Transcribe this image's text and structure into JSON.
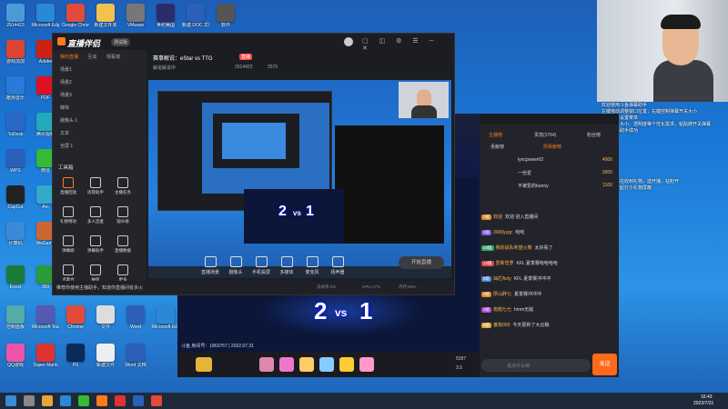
{
  "desktop": {
    "icons": [
      {
        "label": "2914423",
        "color": "#4a9ad8"
      },
      {
        "label": "Microsoft Edge",
        "color": "#2a88d8"
      },
      {
        "label": "Google Chrome",
        "color": "#e24a3b"
      },
      {
        "label": "新建文件夹",
        "color": "#f2c14e"
      },
      {
        "label": "VMware",
        "color": "#777777"
      },
      {
        "label": "世纪美国",
        "color": "#2c2c6c"
      },
      {
        "label": "新建 DOC 文档",
        "color": "#2b5fb8"
      },
      {
        "label": "软件",
        "color": "#555555"
      },
      {
        "label": "游戏加加",
        "color": "#d43"
      },
      {
        "label": "Adobe",
        "color": "#c21"
      },
      {
        "label": "酷狗音乐",
        "color": "#2a7ad8"
      },
      {
        "label": "PDF",
        "color": "#d12"
      },
      {
        "label": "ToDesk",
        "color": "#2a68c8"
      },
      {
        "label": "腾讯视频",
        "color": "#2ab"
      },
      {
        "label": "WPS",
        "color": "#2b5fb8"
      },
      {
        "label": "微信",
        "color": "#3b3"
      },
      {
        "label": "CapCut",
        "color": "#222"
      },
      {
        "label": "Arc",
        "color": "#3ac"
      },
      {
        "label": "计算机",
        "color": "#3a8ad8"
      },
      {
        "label": "WeGame",
        "color": "#c63"
      },
      {
        "label": "Excel",
        "color": "#1a7a3a"
      },
      {
        "label": "360",
        "color": "#2a9a3a"
      },
      {
        "label": "控制面板",
        "color": "#5aa"
      },
      {
        "label": "Microsoft Teams",
        "color": "#5559b0"
      },
      {
        "label": "Chrome",
        "color": "#e24a3b"
      },
      {
        "label": "文件",
        "color": "#ddd"
      },
      {
        "label": "Word",
        "color": "#2b5fb8"
      },
      {
        "label": "Microsoft Edge",
        "color": "#2a88d8"
      },
      {
        "label": "QQ游戏",
        "color": "#e5a"
      },
      {
        "label": "Super Mario",
        "color": "#d33"
      },
      {
        "label": "PS",
        "color": "#0a2a5a"
      },
      {
        "label": "新建文件",
        "color": "#eee"
      },
      {
        "label": "Word 文档",
        "color": "#2b5fb8"
      }
    ]
  },
  "app": {
    "logo": "直播伴侣",
    "version": "测试版",
    "match": "赛事解说：eStar vs TTG",
    "match_tag": "直播",
    "live_notice": "解说解说中",
    "stats": {
      "room_id": "2914423",
      "followers": "2575"
    },
    "tabs": [
      "我的直播",
      "互动",
      "观看端"
    ],
    "scenes": [
      "场景1",
      "场景2",
      "场景3",
      "媒体",
      "摄像头 1",
      "文本",
      "全屏 1"
    ],
    "tools_title": "工具箱",
    "tools": [
      "直播回放",
      "房管助手",
      "主播任务",
      "礼物特效",
      "多人连麦",
      "观众榜",
      "弹幕姬",
      "弹幕助手",
      "直播数据",
      "点歌台",
      "抽奖",
      "更多"
    ],
    "controls": [
      "直播场景",
      "摄像头",
      "手机投屏",
      "多媒体",
      "麦克风",
      "扬声器"
    ],
    "start_button": "开始直播",
    "status": [
      "丢帧率:0%",
      "CPU:17%",
      "内存:50%"
    ],
    "tip": "推荐你使用主播助手，知道你直播间有多火"
  },
  "preview": {
    "score_left": "2",
    "vs": "vs",
    "score_right": "1",
    "room_line": "斗鱼 房间号：1863767 | 2022.07.31"
  },
  "chat": {
    "tabs": [
      "主播榜",
      "贵宾(3764)",
      "粉丝榜"
    ],
    "sub_tabs": [
      "贡献榜",
      "周贡献榜"
    ],
    "ranks": [
      {
        "name": "lyncpower02",
        "value": "4000"
      },
      {
        "name": "一份爱",
        "value": "3000"
      },
      {
        "name": "不被爱的bunny",
        "value": "1100"
      }
    ],
    "messages": [
      {
        "badge": "7级",
        "color": "#e08c2b",
        "user": "欢迎",
        "text": "欢迎  进入直播间"
      },
      {
        "badge": "2级",
        "color": "#7a5ad8",
        "user": "3000yygc",
        "text": "哈哈"
      },
      {
        "badge": "10级",
        "color": "#3aa86b",
        "user": "我的战队希望火熊",
        "text": "太好看了"
      },
      {
        "badge": "12级",
        "color": "#d84a4a",
        "user": "爱新觉罗",
        "text": "KFL 夏季赛哈哈哈哈"
      },
      {
        "badge": "8级",
        "color": "#4a8ad8",
        "user": "灿烂Acty",
        "text": "KFL 夏季赛冲冲冲"
      },
      {
        "badge": "5级",
        "color": "#d88a2a",
        "user": "厚山胖七",
        "text": "夏季赛冲冲冲"
      },
      {
        "badge": "3级",
        "color": "#a84ad8",
        "user": "炮炮七七",
        "text": "hmm无敌"
      },
      {
        "badge": "9级",
        "color": "#e0a43a",
        "user": "番茄000",
        "text": "今天更新了大云稿"
      }
    ],
    "input_placeholder": "说点什么吧",
    "send": "发送",
    "gift_bar": [
      "5287",
      "3.5"
    ]
  },
  "webcam_notice": "欢迎使用斗鱼弹幕助手\n左键拖动调整窗口位置，右键控制弹幕开关大小\n右上角有设置菜单\n设置字体大小、透明度等个性化需求，粘贴牌开关弹幕\n添加弹幕助手成功",
  "overlay_notice": "设置显示在收到礼物，送开播、钻粉开\n不需要开起打小礼物屏蔽",
  "taskbar": {
    "time": "16:43",
    "date": "2022/7/31"
  }
}
